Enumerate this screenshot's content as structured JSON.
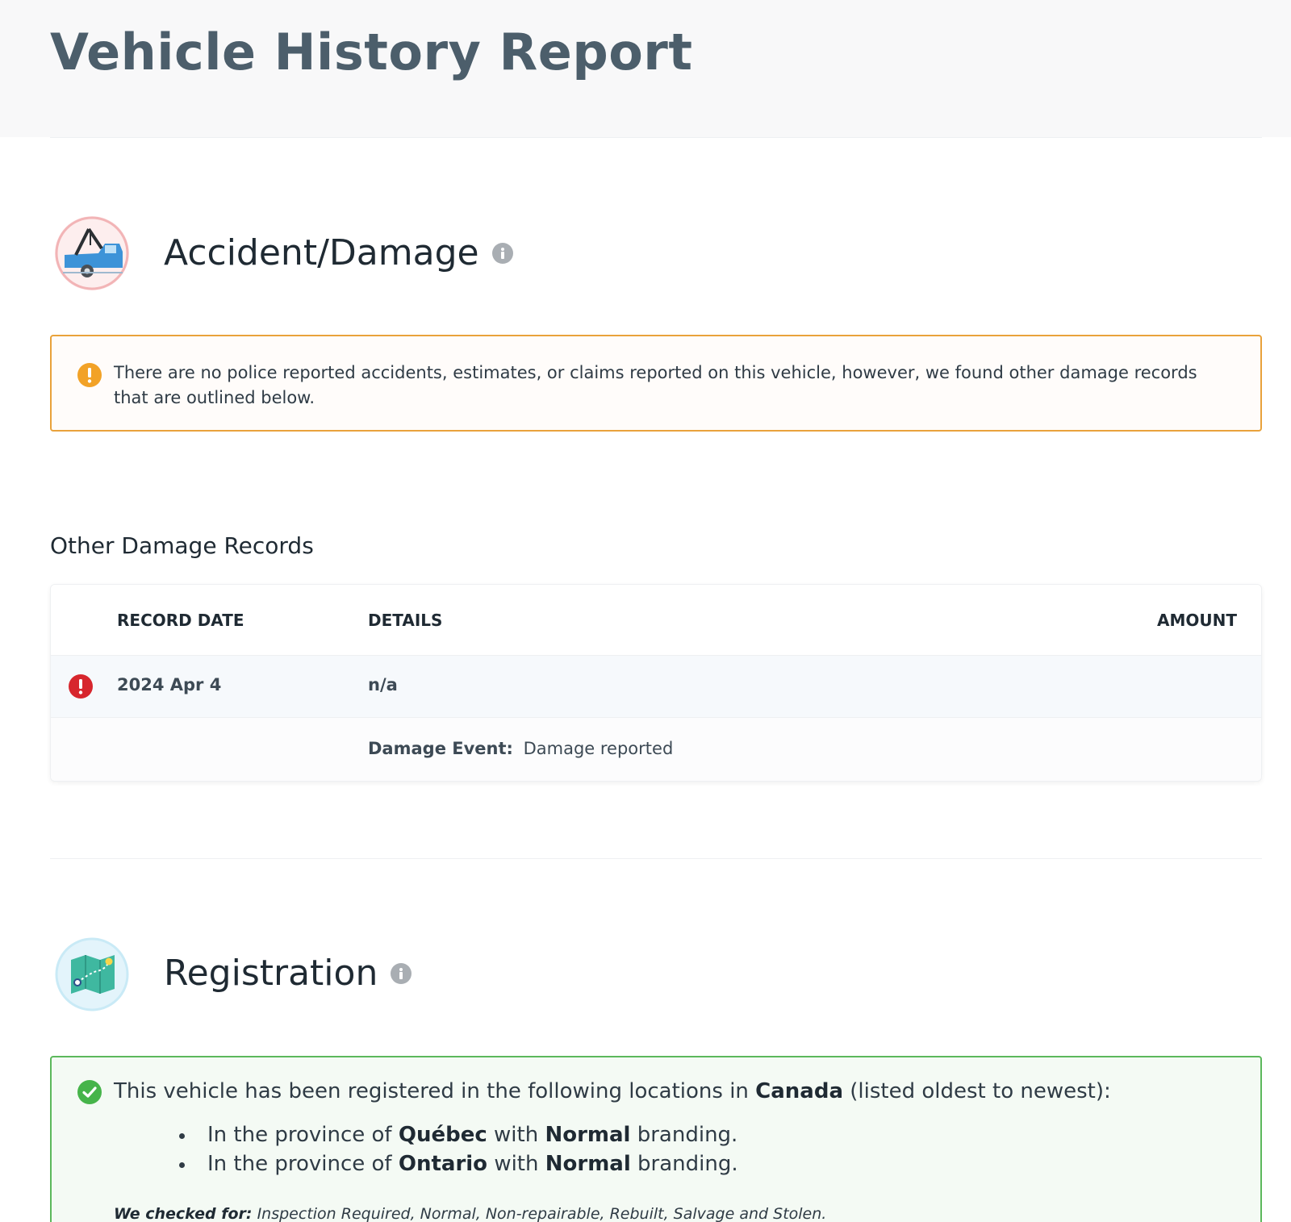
{
  "colors": {
    "title": "#4c5e6b",
    "warning": "#e9a23b",
    "success": "#5cb85c",
    "danger": "#d7262d",
    "info": "#a9aeb3"
  },
  "report": {
    "title": "Vehicle History Report"
  },
  "accident": {
    "icon": "tow-truck-icon",
    "title": "Accident/Damage",
    "alert_text": "There are no police reported accidents, estimates, or claims reported on this vehicle, however, we found other damage records that are outlined below.",
    "other_records_heading": "Other Damage Records",
    "table": {
      "headers": {
        "record_date": "RECORD DATE",
        "details": "DETAILS",
        "amount": "AMOUNT"
      },
      "rows": [
        {
          "status_icon": "danger-exclamation-icon",
          "record_date": "2024 Apr 4",
          "details": "n/a",
          "amount": "",
          "event_label": "Damage Event:",
          "event_value": "Damage reported"
        }
      ]
    }
  },
  "registration": {
    "icon": "map-icon",
    "title": "Registration",
    "intro_prefix": "This vehicle has been registered in the following locations in",
    "country": "Canada",
    "intro_suffix": "(listed oldest to newest):",
    "locations": [
      {
        "prefix": "In the province of",
        "province": "Québec",
        "middle": "with",
        "branding": "Normal",
        "suffix": "branding."
      },
      {
        "prefix": "In the province of",
        "province": "Ontario",
        "middle": "with",
        "branding": "Normal",
        "suffix": "branding."
      }
    ],
    "checked_for_label": "We checked for:",
    "checked_for_value": "Inspection Required, Normal, Non-repairable, Rebuilt, Salvage and Stolen."
  }
}
